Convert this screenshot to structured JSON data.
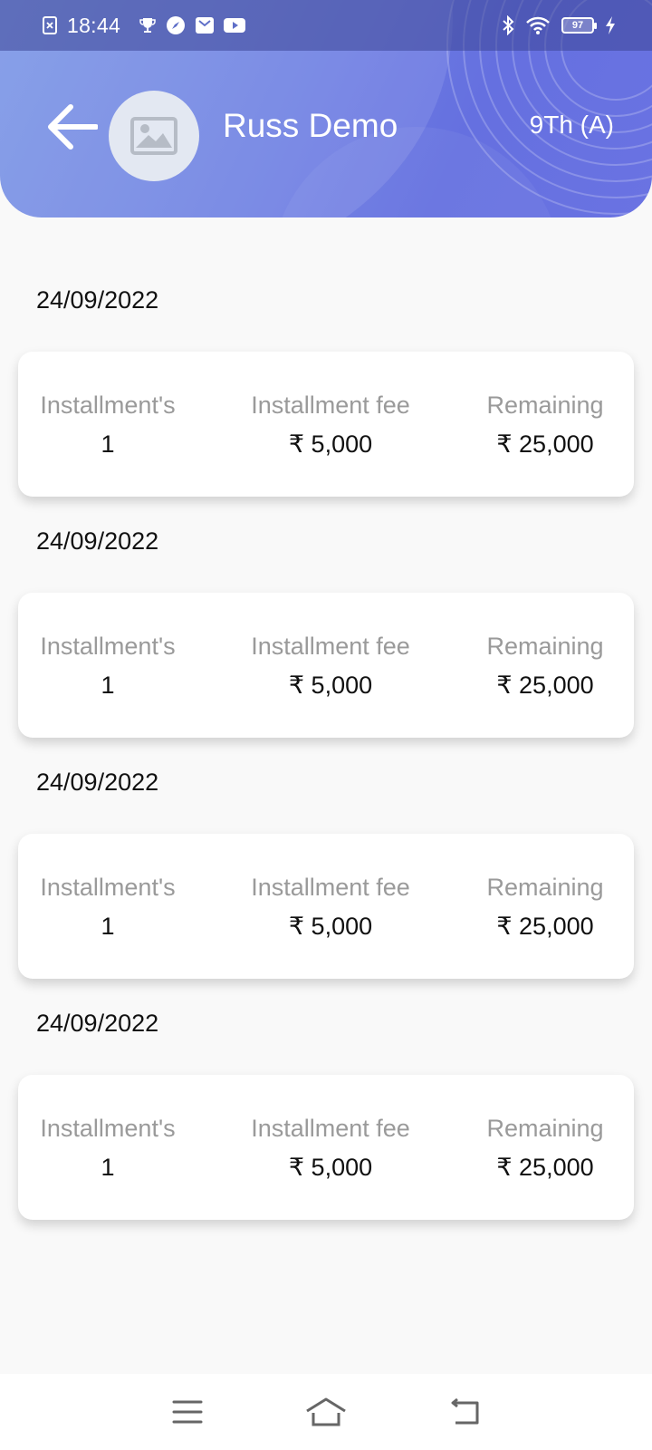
{
  "status_bar": {
    "time": "18:44",
    "battery": "97",
    "left_icons": [
      "screenshot-icon",
      "trophy-icon",
      "compass-icon",
      "mail-icon",
      "youtube-icon"
    ],
    "right_icons": [
      "bluetooth-icon",
      "wifi-icon",
      "battery-icon",
      "charging-icon"
    ]
  },
  "header": {
    "student_name": "Russ Demo",
    "class_label": "9Th (A)",
    "gradient_colors": [
      "#7b96e6",
      "#6570e0"
    ]
  },
  "labels": {
    "installments": "Installment's",
    "installment_fee": "Installment fee",
    "remaining": "Remaining"
  },
  "entries": [
    {
      "date": "24/09/2022",
      "installments": "1",
      "installment_fee": "₹ 5,000",
      "remaining": "₹ 25,000"
    },
    {
      "date": "24/09/2022",
      "installments": "1",
      "installment_fee": "₹ 5,000",
      "remaining": "₹ 25,000"
    },
    {
      "date": "24/09/2022",
      "installments": "1",
      "installment_fee": "₹ 5,000",
      "remaining": "₹ 25,000"
    },
    {
      "date": "24/09/2022",
      "installments": "1",
      "installment_fee": "₹ 5,000",
      "remaining": "₹ 25,000"
    }
  ],
  "nav_bar": [
    "menu-icon",
    "home-icon",
    "back-icon"
  ]
}
